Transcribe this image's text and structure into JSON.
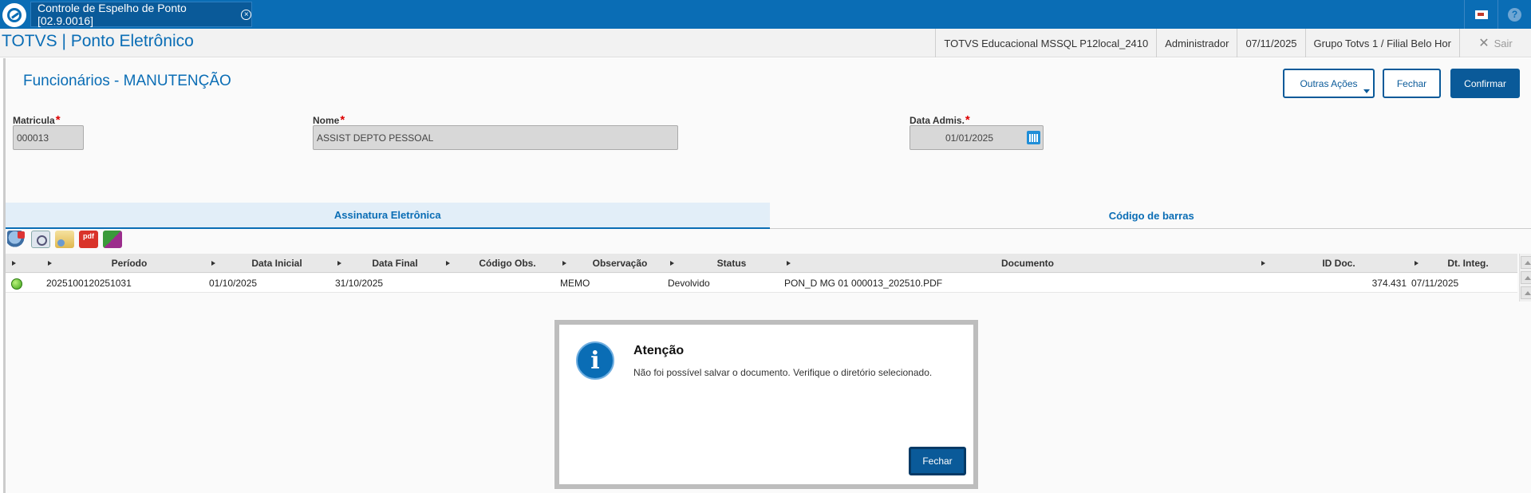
{
  "topbar": {
    "tab_label": "Controle de Espelho de Ponto [02.9.0016]",
    "tab_close": "×",
    "help_label": "?"
  },
  "header": {
    "app_title": "TOTVS | Ponto Eletrônico",
    "environment": "TOTVS Educacional MSSQL P12local_2410",
    "user": "Administrador",
    "date": "07/11/2025",
    "branch": "Grupo Totvs 1 / Filial Belo Hor",
    "logout_label": "Sair",
    "logout_icon": "✕"
  },
  "page": {
    "title": "Funcionários - MANUTENÇÃO",
    "buttons": {
      "other_actions": "Outras Ações",
      "close": "Fechar",
      "confirm": "Confirmar"
    }
  },
  "form": {
    "required_mark": "*",
    "matricula": {
      "label": "Matricula",
      "value": "000013"
    },
    "nome": {
      "label": "Nome",
      "value": "ASSIST DEPTO PESSOAL"
    },
    "data_admis": {
      "label": "Data Admis.",
      "value": "01/01/2025"
    }
  },
  "tabs": [
    {
      "label": "Assinatura Eletrônica",
      "selected": true
    },
    {
      "label": "Código de barras",
      "selected": false
    }
  ],
  "toolbar": {
    "icons": [
      "refresh-icon",
      "view-icon",
      "email-icon",
      "pdf-icon",
      "sign-icon"
    ],
    "pdf_text": "pdf"
  },
  "grid": {
    "columns": [
      "Período",
      "Data Inicial",
      "Data Final",
      "Código Obs.",
      "Observação",
      "Status",
      "Documento",
      "ID Doc.",
      "Dt. Integ."
    ],
    "rows": [
      {
        "status_color": "#3da11a",
        "periodo": "2025100120251031",
        "data_inicial": "01/10/2025",
        "data_final": "31/10/2025",
        "codigo_obs": "",
        "observacao": "MEMO",
        "status": "Devolvido",
        "documento": "PON_D MG 01 000013_202510.PDF",
        "id_doc": "374.431",
        "dt_integ": "07/11/2025"
      }
    ]
  },
  "dialog": {
    "icon": "i",
    "title": "Atenção",
    "message": "Não foi possível salvar o documento. Verifique o diretório selecionado.",
    "button": "Fechar"
  },
  "colors": {
    "brand": "#0a6db5",
    "primary_button": "#0a5a99",
    "required": "#dd0000"
  }
}
